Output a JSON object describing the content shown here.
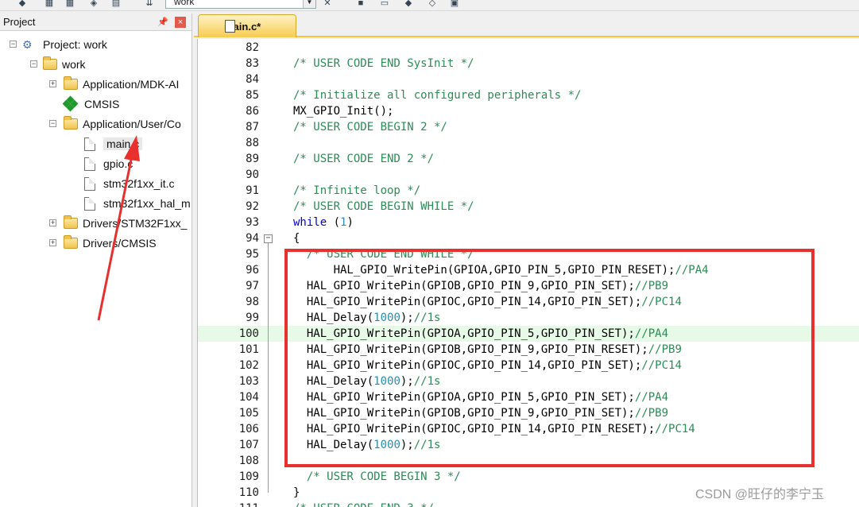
{
  "toolbar": {
    "target_value": "work"
  },
  "project_panel": {
    "title": "Project",
    "tree": [
      {
        "label": "Project: work",
        "icon": "project-icon",
        "expander": "−"
      },
      {
        "label": "work",
        "icon": "target-folder-icon",
        "expander": "−"
      },
      {
        "label": "Application/MDK-AI",
        "icon": "folder-icon",
        "expander": "+"
      },
      {
        "label": "CMSIS",
        "icon": "cmsis-icon"
      },
      {
        "label": "Application/User/Co",
        "icon": "folder-icon",
        "expander": "−"
      },
      {
        "label": "main.c",
        "icon": "file-icon"
      },
      {
        "label": "gpio.c",
        "icon": "file-icon"
      },
      {
        "label": "stm32f1xx_it.c",
        "icon": "file-icon"
      },
      {
        "label": "stm32f1xx_hal_m",
        "icon": "file-icon"
      },
      {
        "label": "Drivers/STM32F1xx_",
        "icon": "folder-icon",
        "expander": "+"
      },
      {
        "label": "Drivers/CMSIS",
        "icon": "folder-icon",
        "expander": "+"
      }
    ]
  },
  "editor": {
    "tab_label": "main.c*",
    "lines": [
      {
        "n": "82",
        "text": ""
      },
      {
        "n": "83",
        "text": "/* USER CODE END SysInit */"
      },
      {
        "n": "84",
        "text": ""
      },
      {
        "n": "85",
        "text": "/* Initialize all configured peripherals */"
      },
      {
        "n": "86",
        "text": "MX_GPIO_Init();"
      },
      {
        "n": "87",
        "text": "/* USER CODE BEGIN 2 */"
      },
      {
        "n": "88",
        "text": ""
      },
      {
        "n": "89",
        "text": "/* USER CODE END 2 */"
      },
      {
        "n": "90",
        "text": ""
      },
      {
        "n": "91",
        "text": "/* Infinite loop */"
      },
      {
        "n": "92",
        "text": "/* USER CODE BEGIN WHILE */"
      },
      {
        "n": "93",
        "text": "while (1)"
      },
      {
        "n": "94",
        "text": "{"
      },
      {
        "n": "95",
        "text": "  /* USER CODE END WHILE */"
      },
      {
        "n": "96",
        "text": "      HAL_GPIO_WritePin(GPIOA,GPIO_PIN_5,GPIO_PIN_RESET);//PA4"
      },
      {
        "n": "97",
        "text": "  HAL_GPIO_WritePin(GPIOB,GPIO_PIN_9,GPIO_PIN_SET);//PB9"
      },
      {
        "n": "98",
        "text": "  HAL_GPIO_WritePin(GPIOC,GPIO_PIN_14,GPIO_PIN_SET);//PC14"
      },
      {
        "n": "99",
        "text": "  HAL_Delay(1000);//1s"
      },
      {
        "n": "100",
        "text": "  HAL_GPIO_WritePin(GPIOA,GPIO_PIN_5,GPIO_PIN_SET);//PA4"
      },
      {
        "n": "101",
        "text": "  HAL_GPIO_WritePin(GPIOB,GPIO_PIN_9,GPIO_PIN_RESET);//PB9"
      },
      {
        "n": "102",
        "text": "  HAL_GPIO_WritePin(GPIOC,GPIO_PIN_14,GPIO_PIN_SET);//PC14"
      },
      {
        "n": "103",
        "text": "  HAL_Delay(1000);//1s"
      },
      {
        "n": "104",
        "text": "  HAL_GPIO_WritePin(GPIOA,GPIO_PIN_5,GPIO_PIN_SET);//PA4"
      },
      {
        "n": "105",
        "text": "  HAL_GPIO_WritePin(GPIOB,GPIO_PIN_9,GPIO_PIN_SET);//PB9"
      },
      {
        "n": "106",
        "text": "  HAL_GPIO_WritePin(GPIOC,GPIO_PIN_14,GPIO_PIN_RESET);//PC14"
      },
      {
        "n": "107",
        "text": "  HAL_Delay(1000);//1s"
      },
      {
        "n": "108",
        "text": ""
      },
      {
        "n": "109",
        "text": "  /* USER CODE BEGIN 3 */"
      },
      {
        "n": "110",
        "text": "}"
      },
      {
        "n": "111",
        "text": "/* USER CODE END 3 */"
      }
    ]
  },
  "watermark": "CSDN @旺仔的李宁玉",
  "colors": {
    "comment": "#2e8b57",
    "number": "#2e8bb0",
    "keyword": "#0000d0",
    "annotation": "#e8302f",
    "tab": "#f6cc4f"
  }
}
